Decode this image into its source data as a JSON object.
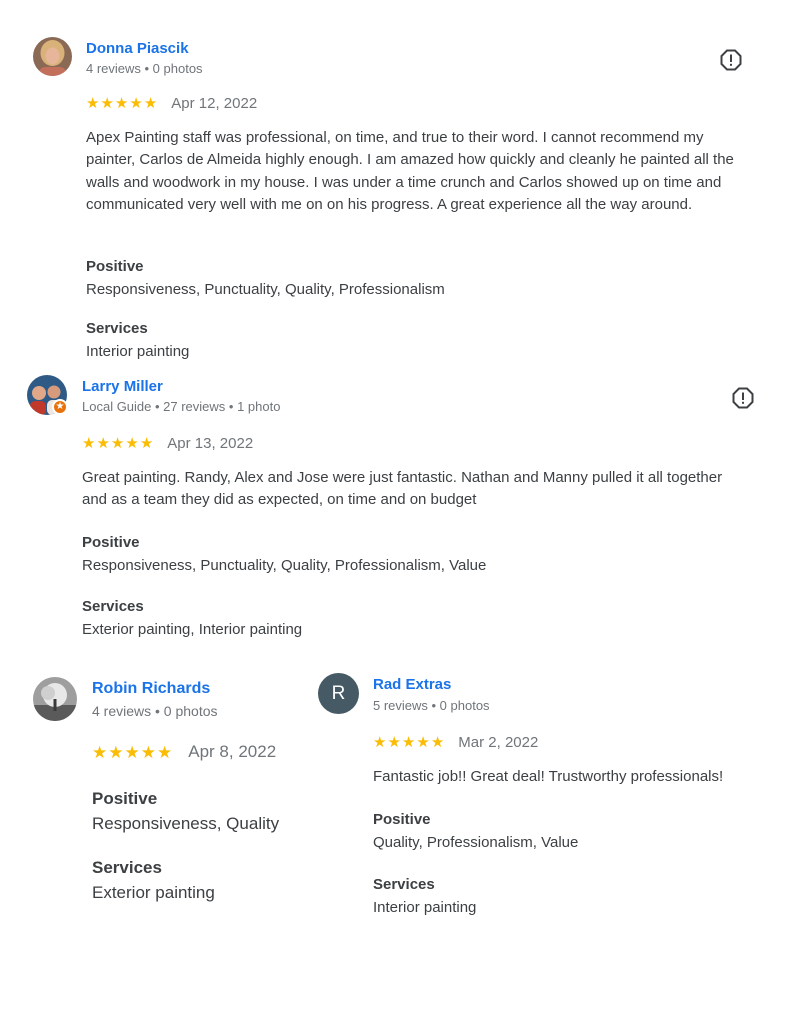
{
  "reviews": [
    {
      "name": "Donna Piascik",
      "meta": "4 reviews • 0 photos",
      "rating": 5,
      "date": "Apr 12, 2022",
      "text": "Apex Painting staff was professional, on time, and true to their word. I cannot recommend my painter, Carlos de Almeida highly enough. I am amazed how quickly and cleanly he painted all the walls and woodwork in my house. I was under a time crunch and Carlos showed up on time and communicated very well with me on on his progress. A great experience all the way around.",
      "positive_label": "Positive",
      "positive_value": "Responsiveness, Punctuality, Quality, Professionalism",
      "services_label": "Services",
      "services_value": "Interior painting"
    },
    {
      "name": "Larry Miller",
      "meta": "Local Guide • 27 reviews • 1 photo",
      "rating": 5,
      "date": "Apr 13, 2022",
      "text": "Great painting. Randy, Alex and Jose were just fantastic. Nathan and Manny pulled it all together and as a team they did as expected, on time and on budget",
      "positive_label": "Positive",
      "positive_value": "Responsiveness, Punctuality, Quality, Professionalism, Value",
      "services_label": "Services",
      "services_value": "Exterior painting, Interior painting"
    },
    {
      "name": "Robin Richards",
      "meta": "4 reviews • 0 photos",
      "rating": 5,
      "date": "Apr 8, 2022",
      "positive_label": "Positive",
      "positive_value": "Responsiveness, Quality",
      "services_label": "Services",
      "services_value": "Exterior painting"
    },
    {
      "name": "Rad Extras",
      "avatar_letter": "R",
      "meta": "5 reviews • 0 photos",
      "rating": 5,
      "date": "Mar 2, 2022",
      "text": "Fantastic job!! Great deal! Trustworthy professionals!",
      "positive_label": "Positive",
      "positive_value": "Quality, Professionalism, Value",
      "services_label": "Services",
      "services_value": "Interior painting"
    }
  ],
  "colors": {
    "name_link": "#1a73e8",
    "star": "#fbbc04",
    "meta": "#70757a",
    "letter_avatar_bg": "#455a64",
    "local_guide_badge": "#e8710a"
  },
  "icons": {
    "report": "report-flag-icon",
    "star": "star-icon",
    "local_guide": "local-guide-badge-icon"
  }
}
